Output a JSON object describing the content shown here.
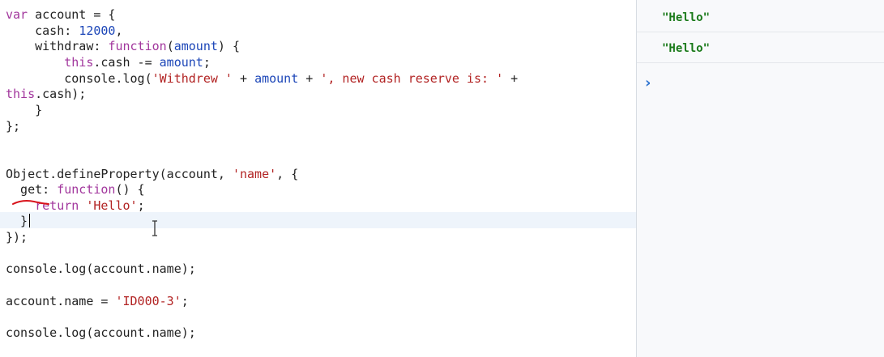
{
  "editor": {
    "lines": [
      [
        {
          "t": "var",
          "c": "kw"
        },
        {
          "t": " account = {",
          "c": "plain"
        }
      ],
      [
        {
          "t": "    cash: ",
          "c": "plain"
        },
        {
          "t": "12000",
          "c": "num"
        },
        {
          "t": ",",
          "c": "plain"
        }
      ],
      [
        {
          "t": "    withdraw: ",
          "c": "plain"
        },
        {
          "t": "function",
          "c": "kw"
        },
        {
          "t": "(",
          "c": "plain"
        },
        {
          "t": "amount",
          "c": "var"
        },
        {
          "t": ") {",
          "c": "plain"
        }
      ],
      [
        {
          "t": "        ",
          "c": "plain"
        },
        {
          "t": "this",
          "c": "kw"
        },
        {
          "t": ".cash -= ",
          "c": "plain"
        },
        {
          "t": "amount",
          "c": "var"
        },
        {
          "t": ";",
          "c": "plain"
        }
      ],
      [
        {
          "t": "        console.log(",
          "c": "plain"
        },
        {
          "t": "'Withdrew '",
          "c": "str"
        },
        {
          "t": " + ",
          "c": "plain"
        },
        {
          "t": "amount",
          "c": "var"
        },
        {
          "t": " + ",
          "c": "plain"
        },
        {
          "t": "', new cash reserve is: '",
          "c": "str"
        },
        {
          "t": " +",
          "c": "plain"
        }
      ],
      [
        {
          "t": "this",
          "c": "kw"
        },
        {
          "t": ".cash);",
          "c": "plain"
        }
      ],
      [
        {
          "t": "    }",
          "c": "plain"
        }
      ],
      [
        {
          "t": "};",
          "c": "plain"
        }
      ],
      [],
      [],
      [
        {
          "t": "Object.defineProperty(account, ",
          "c": "plain"
        },
        {
          "t": "'name'",
          "c": "str"
        },
        {
          "t": ", {",
          "c": "plain"
        }
      ],
      [
        {
          "t": "  get: ",
          "c": "plain"
        },
        {
          "t": "function",
          "c": "kw"
        },
        {
          "t": "() {",
          "c": "plain"
        }
      ],
      [
        {
          "t": "    ",
          "c": "plain"
        },
        {
          "t": "return",
          "c": "kw"
        },
        {
          "t": " ",
          "c": "plain"
        },
        {
          "t": "'Hello'",
          "c": "str"
        },
        {
          "t": ";",
          "c": "plain"
        }
      ],
      [
        {
          "t": "  }",
          "c": "plain"
        }
      ],
      [
        {
          "t": "});",
          "c": "plain"
        }
      ],
      [],
      [
        {
          "t": "console.log(account.name);",
          "c": "plain"
        }
      ],
      [],
      [
        {
          "t": "account.name = ",
          "c": "plain"
        },
        {
          "t": "'ID000-3'",
          "c": "str"
        },
        {
          "t": ";",
          "c": "plain"
        }
      ],
      [],
      [
        {
          "t": "console.log(account.name);",
          "c": "plain"
        }
      ]
    ]
  },
  "console": {
    "outputs": [
      "\"Hello\"",
      "\"Hello\""
    ],
    "prompt_icon": "chevron-right-icon"
  },
  "colors": {
    "keyword": "#a2379d",
    "number": "#1c46b8",
    "string": "#b22323",
    "variable": "#1c46b8",
    "console_string": "#1a7a1a",
    "prompt": "#2f74d0",
    "annotation": "#d8141c"
  }
}
